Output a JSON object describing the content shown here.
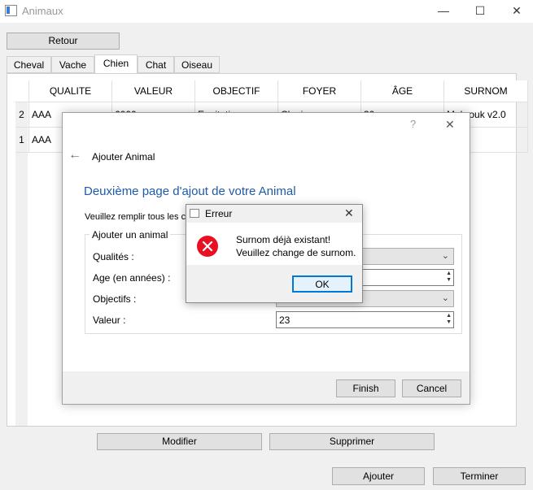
{
  "window": {
    "title": "Animaux"
  },
  "toolbar": {
    "back_label": "Retour"
  },
  "tabs": [
    {
      "label": "Cheval"
    },
    {
      "label": "Vache"
    },
    {
      "label": "Chien"
    },
    {
      "label": "Chat"
    },
    {
      "label": "Oiseau"
    }
  ],
  "active_tab": "Chien",
  "table": {
    "columns": [
      "QUALITE",
      "VALEUR",
      "OBJECTIF",
      "FOYER",
      "ÂGE",
      "SURNOM"
    ],
    "rows": [
      {
        "num": "2",
        "cells": [
          "AAA",
          "6000",
          "Equitation",
          "Clapier",
          "30",
          "Mabrouk v2.0"
        ]
      },
      {
        "num": "1",
        "cells": [
          "AAA",
          "",
          "",
          "",
          "",
          ""
        ]
      }
    ]
  },
  "bottom_buttons": {
    "modify": "Modifier",
    "delete": "Supprimer",
    "add": "Ajouter",
    "finish": "Terminer"
  },
  "wizard": {
    "help_glyph": "?",
    "close_glyph": "✕",
    "back_glyph": "←",
    "header": "Ajouter Animal",
    "page_title": "Deuxième page d'ajout de votre Animal",
    "instruction": "Veuillez remplir tous les ch",
    "group_title": "Ajouter un animal",
    "fields": {
      "qualites": {
        "label": "Qualités :",
        "value": ""
      },
      "age": {
        "label": "Age (en années) :",
        "value": ""
      },
      "objectifs": {
        "label": "Objectifs :",
        "value": ""
      },
      "valeur": {
        "label": "Valeur :",
        "value": "23"
      }
    },
    "finish_label": "Finish",
    "cancel_label": "Cancel"
  },
  "error_dialog": {
    "title": "Erreur",
    "close_glyph": "✕",
    "line1": "Surnom déjà existant!",
    "line2": "Veuillez change de surnom.",
    "ok_label": "OK",
    "icon": "error-x-icon"
  },
  "colors": {
    "accent": "#1f5aa8",
    "error": "#e81123",
    "ok_border": "#0078d7"
  }
}
